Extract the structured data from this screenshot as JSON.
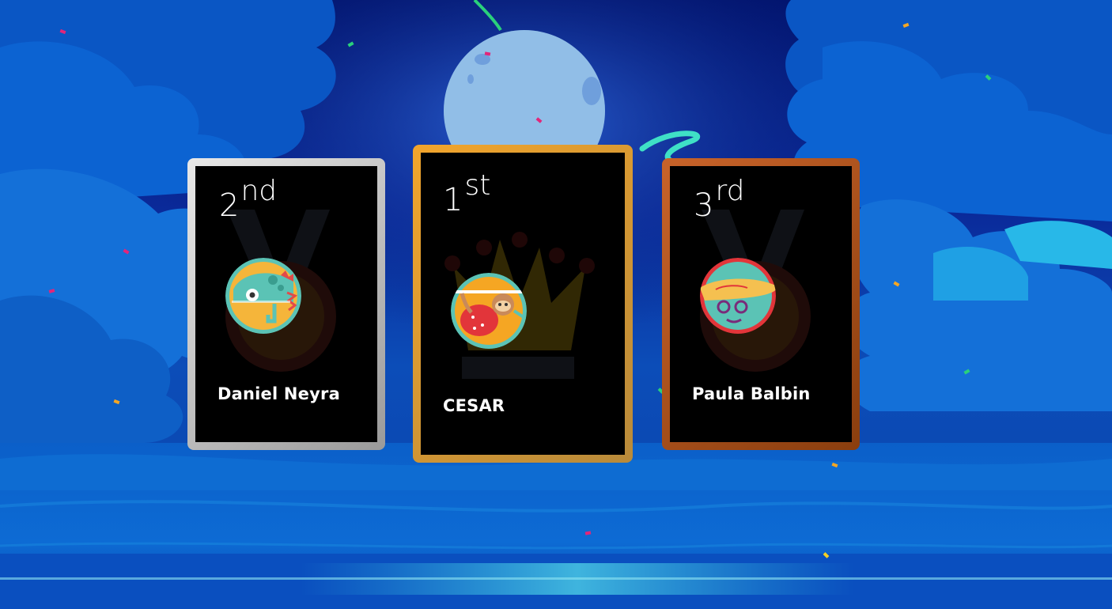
{
  "podium": [
    {
      "place": "second",
      "rank_number": "2",
      "rank_suffix": "nd",
      "player_name": "Daniel Neyra",
      "avatar": "chameleon-avatar-icon",
      "badge": "medal-icon",
      "frame_color": "#c9c9c9"
    },
    {
      "place": "first",
      "rank_number": "1",
      "rank_suffix": "st",
      "player_name": "CESAR",
      "avatar": "sloth-avatar-icon",
      "badge": "crown-icon",
      "frame_color": "#e7a233"
    },
    {
      "place": "third",
      "rank_number": "3",
      "rank_suffix": "rd",
      "player_name": "Paula Balbin",
      "avatar": "lizard-avatar-icon",
      "badge": "medal-icon",
      "frame_color": "#b35a1e"
    }
  ],
  "colors": {
    "silver": "#c9c9c9",
    "gold": "#e7a233",
    "bronze": "#b35a1e",
    "sky": "#02146e",
    "moon": "#8ab4e6"
  }
}
